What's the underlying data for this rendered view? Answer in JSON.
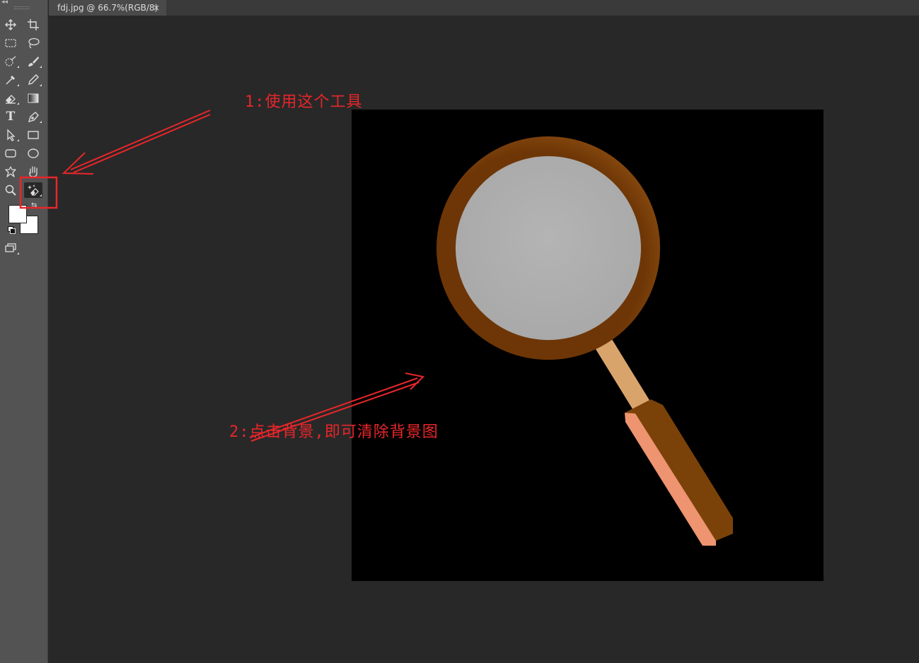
{
  "document_tab": {
    "title": "fdj.jpg @ 66.7%(RGB/8)",
    "close_glyph": "×"
  },
  "toolbar": {
    "tools": [
      "move-tool",
      "crop-tool",
      "rectangular-marquee-tool",
      "lasso-tool",
      "quick-selection-tool",
      "brush-tool",
      "eyedropper-tool",
      "pencil-tool",
      "eraser-tool",
      "gradient-tool",
      "type-tool",
      "pen-tool",
      "path-selection-tool",
      "rectangle-tool",
      "rounded-rectangle-tool",
      "ellipse-tool",
      "custom-shape-tool",
      "hand-tool",
      "zoom-tool",
      "magic-eraser-tool",
      "screen-mode-tool"
    ],
    "type_tool_glyph": "T",
    "active_tool": "magic-eraser-tool",
    "foreground_color": "#ffffff",
    "background_color": "#ffffff",
    "swap_glyph": "⇆"
  },
  "annotations": {
    "step1": "1:使用这个工具",
    "step2": "2:点击背景,即可清除背景图",
    "color": "#e8262a"
  },
  "canvas": {
    "background": "#000000",
    "content": "magnifying-glass",
    "colors": {
      "rim": "#7a3e0a",
      "lens": "#b0b0b0",
      "shaft": "#d9a46b",
      "handle": "#7a4208",
      "handle_side": "#ee9470"
    }
  }
}
